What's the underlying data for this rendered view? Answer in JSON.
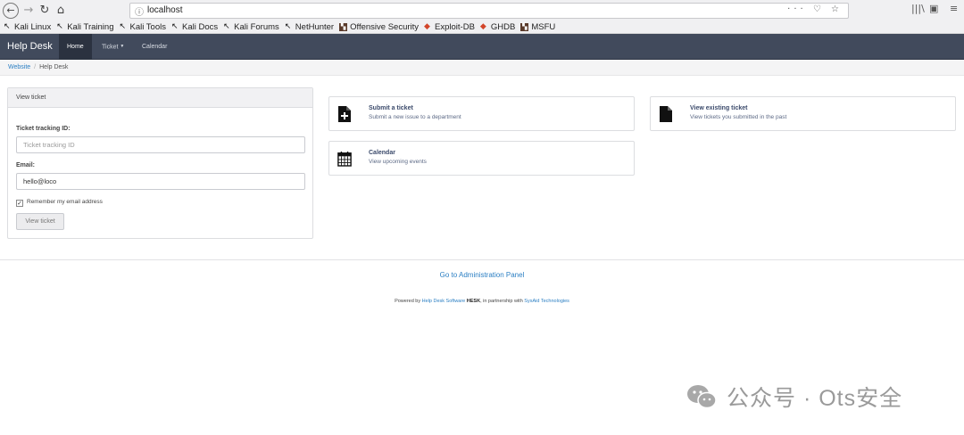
{
  "browser": {
    "url": "localhost",
    "url_right_icons": "··· ♡ ☆",
    "bookmarks": [
      {
        "label": "Kali Linux",
        "icon": "kali-dragon-icon"
      },
      {
        "label": "Kali Training",
        "icon": "kali-dragon-icon"
      },
      {
        "label": "Kali Tools",
        "icon": "kali-dragon-icon"
      },
      {
        "label": "Kali Docs",
        "icon": "kali-dragon-icon"
      },
      {
        "label": "Kali Forums",
        "icon": "kali-dragon-icon"
      },
      {
        "label": "NetHunter",
        "icon": "kali-dragon-icon"
      },
      {
        "label": "Offensive Security",
        "icon": "offsec-icon"
      },
      {
        "label": "Exploit-DB",
        "icon": "exploitdb-icon"
      },
      {
        "label": "GHDB",
        "icon": "exploitdb-icon"
      },
      {
        "label": "MSFU",
        "icon": "offsec-icon"
      }
    ]
  },
  "navbar": {
    "brand": "Help Desk",
    "items": [
      {
        "label": "Home"
      },
      {
        "label": "Ticket"
      },
      {
        "label": "Calendar"
      }
    ]
  },
  "breadcrumb": {
    "root": "Website",
    "current": "Help Desk"
  },
  "view_ticket": {
    "heading": "View ticket",
    "tracking_label": "Ticket tracking ID:",
    "tracking_placeholder": "Ticket tracking ID",
    "email_label": "Email:",
    "email_value": "hello@loco",
    "remember_label": "Remember my email address",
    "remember_checked": true,
    "button": "View ticket"
  },
  "cards": [
    {
      "title": "Submit a ticket",
      "subtitle": "Submit a new issue to a department",
      "icon": "new-document-icon"
    },
    {
      "title": "View existing ticket",
      "subtitle": "View tickets you submitted in the past",
      "icon": "document-icon"
    },
    {
      "title": "Calendar",
      "subtitle": "View upcoming events",
      "icon": "calendar-icon"
    }
  ],
  "footer": {
    "admin_link": "Go to Administration Panel",
    "powered_prefix": "Powered by ",
    "powered_link1": "Help Desk Software",
    "powered_brand": "HESK",
    "powered_mid": ", in partnership with ",
    "powered_link2": "SysAid Technologies"
  },
  "watermark": {
    "text": "公众号 · Ots安全"
  },
  "colors": {
    "navbar": "#414a5c",
    "link": "#2b7fc3",
    "card_title": "#3b4a6b"
  }
}
